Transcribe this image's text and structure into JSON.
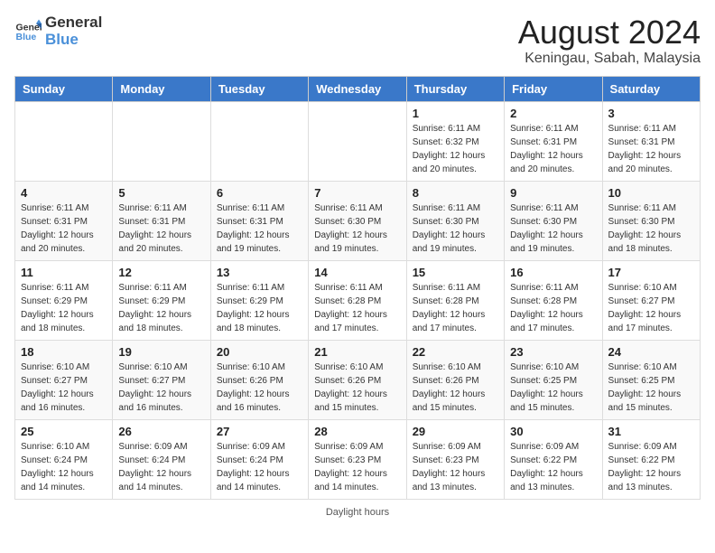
{
  "header": {
    "logo_general": "General",
    "logo_blue": "Blue",
    "month_year": "August 2024",
    "location": "Keningau, Sabah, Malaysia"
  },
  "days_of_week": [
    "Sunday",
    "Monday",
    "Tuesday",
    "Wednesday",
    "Thursday",
    "Friday",
    "Saturday"
  ],
  "weeks": [
    [
      {
        "day": "",
        "info": ""
      },
      {
        "day": "",
        "info": ""
      },
      {
        "day": "",
        "info": ""
      },
      {
        "day": "",
        "info": ""
      },
      {
        "day": "1",
        "info": "Sunrise: 6:11 AM\nSunset: 6:32 PM\nDaylight: 12 hours\nand 20 minutes."
      },
      {
        "day": "2",
        "info": "Sunrise: 6:11 AM\nSunset: 6:31 PM\nDaylight: 12 hours\nand 20 minutes."
      },
      {
        "day": "3",
        "info": "Sunrise: 6:11 AM\nSunset: 6:31 PM\nDaylight: 12 hours\nand 20 minutes."
      }
    ],
    [
      {
        "day": "4",
        "info": "Sunrise: 6:11 AM\nSunset: 6:31 PM\nDaylight: 12 hours\nand 20 minutes."
      },
      {
        "day": "5",
        "info": "Sunrise: 6:11 AM\nSunset: 6:31 PM\nDaylight: 12 hours\nand 20 minutes."
      },
      {
        "day": "6",
        "info": "Sunrise: 6:11 AM\nSunset: 6:31 PM\nDaylight: 12 hours\nand 19 minutes."
      },
      {
        "day": "7",
        "info": "Sunrise: 6:11 AM\nSunset: 6:30 PM\nDaylight: 12 hours\nand 19 minutes."
      },
      {
        "day": "8",
        "info": "Sunrise: 6:11 AM\nSunset: 6:30 PM\nDaylight: 12 hours\nand 19 minutes."
      },
      {
        "day": "9",
        "info": "Sunrise: 6:11 AM\nSunset: 6:30 PM\nDaylight: 12 hours\nand 19 minutes."
      },
      {
        "day": "10",
        "info": "Sunrise: 6:11 AM\nSunset: 6:30 PM\nDaylight: 12 hours\nand 18 minutes."
      }
    ],
    [
      {
        "day": "11",
        "info": "Sunrise: 6:11 AM\nSunset: 6:29 PM\nDaylight: 12 hours\nand 18 minutes."
      },
      {
        "day": "12",
        "info": "Sunrise: 6:11 AM\nSunset: 6:29 PM\nDaylight: 12 hours\nand 18 minutes."
      },
      {
        "day": "13",
        "info": "Sunrise: 6:11 AM\nSunset: 6:29 PM\nDaylight: 12 hours\nand 18 minutes."
      },
      {
        "day": "14",
        "info": "Sunrise: 6:11 AM\nSunset: 6:28 PM\nDaylight: 12 hours\nand 17 minutes."
      },
      {
        "day": "15",
        "info": "Sunrise: 6:11 AM\nSunset: 6:28 PM\nDaylight: 12 hours\nand 17 minutes."
      },
      {
        "day": "16",
        "info": "Sunrise: 6:11 AM\nSunset: 6:28 PM\nDaylight: 12 hours\nand 17 minutes."
      },
      {
        "day": "17",
        "info": "Sunrise: 6:10 AM\nSunset: 6:27 PM\nDaylight: 12 hours\nand 17 minutes."
      }
    ],
    [
      {
        "day": "18",
        "info": "Sunrise: 6:10 AM\nSunset: 6:27 PM\nDaylight: 12 hours\nand 16 minutes."
      },
      {
        "day": "19",
        "info": "Sunrise: 6:10 AM\nSunset: 6:27 PM\nDaylight: 12 hours\nand 16 minutes."
      },
      {
        "day": "20",
        "info": "Sunrise: 6:10 AM\nSunset: 6:26 PM\nDaylight: 12 hours\nand 16 minutes."
      },
      {
        "day": "21",
        "info": "Sunrise: 6:10 AM\nSunset: 6:26 PM\nDaylight: 12 hours\nand 15 minutes."
      },
      {
        "day": "22",
        "info": "Sunrise: 6:10 AM\nSunset: 6:26 PM\nDaylight: 12 hours\nand 15 minutes."
      },
      {
        "day": "23",
        "info": "Sunrise: 6:10 AM\nSunset: 6:25 PM\nDaylight: 12 hours\nand 15 minutes."
      },
      {
        "day": "24",
        "info": "Sunrise: 6:10 AM\nSunset: 6:25 PM\nDaylight: 12 hours\nand 15 minutes."
      }
    ],
    [
      {
        "day": "25",
        "info": "Sunrise: 6:10 AM\nSunset: 6:24 PM\nDaylight: 12 hours\nand 14 minutes."
      },
      {
        "day": "26",
        "info": "Sunrise: 6:09 AM\nSunset: 6:24 PM\nDaylight: 12 hours\nand 14 minutes."
      },
      {
        "day": "27",
        "info": "Sunrise: 6:09 AM\nSunset: 6:24 PM\nDaylight: 12 hours\nand 14 minutes."
      },
      {
        "day": "28",
        "info": "Sunrise: 6:09 AM\nSunset: 6:23 PM\nDaylight: 12 hours\nand 14 minutes."
      },
      {
        "day": "29",
        "info": "Sunrise: 6:09 AM\nSunset: 6:23 PM\nDaylight: 12 hours\nand 13 minutes."
      },
      {
        "day": "30",
        "info": "Sunrise: 6:09 AM\nSunset: 6:22 PM\nDaylight: 12 hours\nand 13 minutes."
      },
      {
        "day": "31",
        "info": "Sunrise: 6:09 AM\nSunset: 6:22 PM\nDaylight: 12 hours\nand 13 minutes."
      }
    ]
  ],
  "footer": {
    "note": "Daylight hours"
  }
}
